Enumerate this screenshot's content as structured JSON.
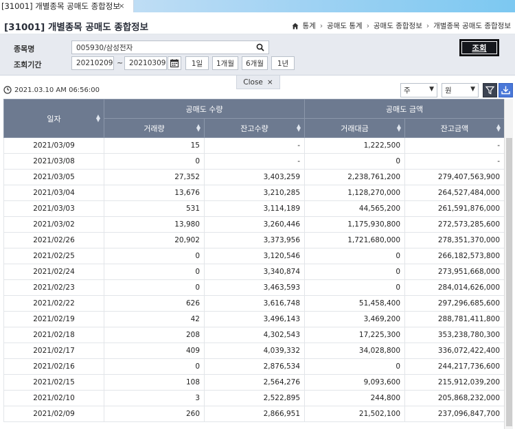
{
  "tab": {
    "title": "[31001] 개별종목 공매도 종합정보",
    "close": "×"
  },
  "page_title": "[31001] 개별종목 공매도 종합정보",
  "breadcrumb": [
    "통계",
    "공매도 통계",
    "공매도 종합정보",
    "개별종목 공매도 종합정보"
  ],
  "form": {
    "stock_label": "종목명",
    "stock_value": "005930/삼성전자",
    "period_label": "조회기간",
    "date_from": "20210209",
    "date_separator": "~",
    "date_to": "20210309",
    "range_buttons": [
      "1일",
      "1개월",
      "6개월",
      "1년"
    ],
    "query_button": "조회",
    "close_label": "Close",
    "close_icon": "×"
  },
  "meta": {
    "timestamp": "2021.03.10 AM 06:56:00",
    "period_select": "주",
    "unit_select": "원"
  },
  "table": {
    "headers": {
      "date": "일자",
      "qty_group": "공매도 수량",
      "amt_group": "공매도 금액",
      "volume": "거래량",
      "balance_qty": "잔고수량",
      "value": "거래대금",
      "balance_amt": "잔고금액"
    },
    "rows": [
      [
        "2021/03/09",
        "15",
        "-",
        "1,222,500",
        "-"
      ],
      [
        "2021/03/08",
        "0",
        "-",
        "0",
        "-"
      ],
      [
        "2021/03/05",
        "27,352",
        "3,403,259",
        "2,238,761,200",
        "279,407,563,900"
      ],
      [
        "2021/03/04",
        "13,676",
        "3,210,285",
        "1,128,270,000",
        "264,527,484,000"
      ],
      [
        "2021/03/03",
        "531",
        "3,114,189",
        "44,565,200",
        "261,591,876,000"
      ],
      [
        "2021/03/02",
        "13,980",
        "3,260,446",
        "1,175,930,800",
        "272,573,285,600"
      ],
      [
        "2021/02/26",
        "20,902",
        "3,373,956",
        "1,721,680,000",
        "278,351,370,000"
      ],
      [
        "2021/02/25",
        "0",
        "3,120,546",
        "0",
        "266,182,573,800"
      ],
      [
        "2021/02/24",
        "0",
        "3,340,874",
        "0",
        "273,951,668,000"
      ],
      [
        "2021/02/23",
        "0",
        "3,463,593",
        "0",
        "284,014,626,000"
      ],
      [
        "2021/02/22",
        "626",
        "3,616,748",
        "51,458,400",
        "297,296,685,600"
      ],
      [
        "2021/02/19",
        "42",
        "3,496,143",
        "3,469,200",
        "288,781,411,800"
      ],
      [
        "2021/02/18",
        "208",
        "4,302,543",
        "17,225,300",
        "353,238,780,300"
      ],
      [
        "2021/02/17",
        "409",
        "4,039,332",
        "34,028,800",
        "336,072,422,400"
      ],
      [
        "2021/02/16",
        "0",
        "2,876,534",
        "0",
        "244,217,736,600"
      ],
      [
        "2021/02/15",
        "108",
        "2,564,276",
        "9,093,600",
        "215,912,039,200"
      ],
      [
        "2021/02/10",
        "3",
        "2,522,895",
        "244,800",
        "205,868,232,000"
      ],
      [
        "2021/02/09",
        "260",
        "2,866,951",
        "21,502,100",
        "237,096,847,700"
      ]
    ]
  }
}
